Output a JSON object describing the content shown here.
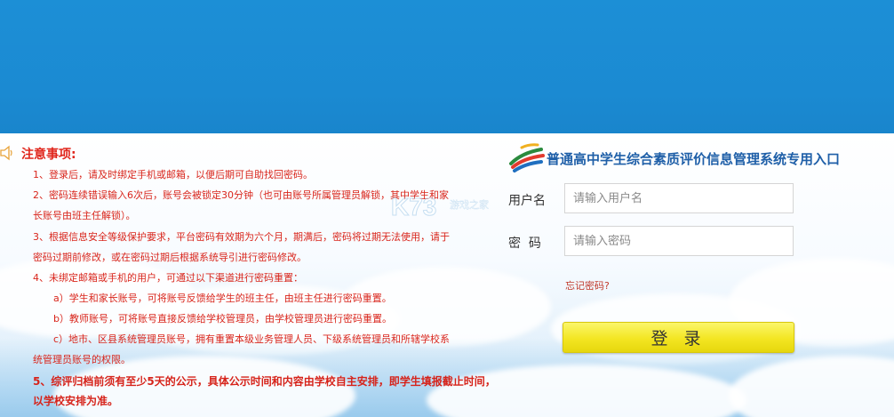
{
  "notice": {
    "title": "注意事项:",
    "items": [
      "1、登录后，请及时绑定手机或邮箱，以便后期可自助找回密码。",
      "2、密码连续错误输入6次后，账号会被锁定30分钟（也可由账号所属管理员解锁，其中学生和家",
      "长账号由班主任解锁）。",
      "3、根据信息安全等级保护要求，平台密码有效期为六个月，期满后，密码将过期无法使用，请于",
      "密码过期前修改，或在密码过期后根据系统导引进行密码修改。",
      "4、未绑定邮箱或手机的用户，可通过以下渠道进行密码重置：",
      "a）学生和家长账号，可将账号反馈给学生的班主任，由班主任进行密码重置。",
      "b）教师账号，可将账号直接反馈给学校管理员，由学校管理员进行密码重置。",
      "c）地市、区县系统管理员账号，拥有重置本级业务管理人员、下级系统管理员和所辖学校系",
      "统管理员账号的权限。"
    ],
    "bold_items": [
      "5、综评归档前须有至少5天的公示，具体公示时间和内容由学校自主安排，即学生填报截止时间，",
      "以学校安排为准。"
    ]
  },
  "login": {
    "system_title": "普通高中学生综合素质评价信息管理系统专用入口",
    "username_label": "用户名",
    "username_placeholder": "请输入用户名",
    "password_label": "密  码",
    "password_placeholder": "请输入密码",
    "forgot_link": "忘记密码?",
    "login_button": "登 录"
  },
  "watermark": {
    "brand": "K73",
    "subtitle": "游戏之家"
  },
  "icons": {
    "notice": "speaker-icon",
    "logo": "system-logo-icon"
  },
  "colors": {
    "banner": "#1b8ad2",
    "notice_red": "#d9261c",
    "title_blue": "#1f5fa8",
    "button_yellow": "#f3e622"
  }
}
